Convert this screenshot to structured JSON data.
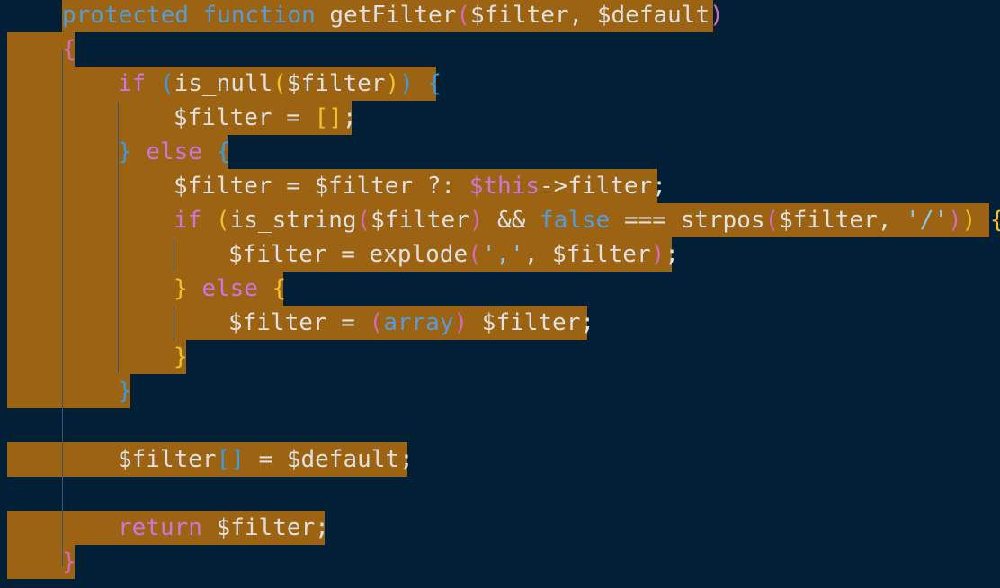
{
  "editor": {
    "language": "php",
    "colors": {
      "background": "#012036",
      "selection": "#9b6312",
      "keyword_purple": "#c778dd",
      "keyword_blue": "#569cd6",
      "text": "#e0e0e0",
      "bracket_gold": "#f2c224",
      "bracket_pink": "#d46ab8",
      "bracket_blue": "#3b9ae1",
      "string": "#8fc6e8"
    },
    "lines": [
      {
        "tokens": [
          [
            "protected",
            "kw-blue"
          ],
          [
            " ",
            ""
          ],
          [
            "function",
            "kw-blue"
          ],
          [
            " getFilter",
            "text"
          ],
          [
            "(",
            "b-pink"
          ],
          [
            "$filter, $default",
            "text"
          ],
          [
            ")",
            "b-pink"
          ]
        ]
      },
      {
        "tokens": [
          [
            "{",
            "b-pink"
          ]
        ]
      },
      {
        "tokens": [
          [
            "if",
            "kw-purple"
          ],
          [
            " ",
            ""
          ],
          [
            "(",
            "b-blue"
          ],
          [
            "is_null",
            "text"
          ],
          [
            "(",
            "b-gold"
          ],
          [
            "$filter",
            "text"
          ],
          [
            ")",
            "b-gold"
          ],
          [
            ")",
            "b-blue"
          ],
          [
            " ",
            ""
          ],
          [
            "{",
            "b-blue"
          ]
        ]
      },
      {
        "tokens": [
          [
            "$filter = ",
            "text"
          ],
          [
            "[]",
            "b-gold"
          ],
          [
            ";",
            "text"
          ]
        ]
      },
      {
        "tokens": [
          [
            "}",
            "b-blue"
          ],
          [
            " ",
            ""
          ],
          [
            "else",
            "kw-purple"
          ],
          [
            " ",
            ""
          ],
          [
            "{",
            "b-blue"
          ]
        ]
      },
      {
        "tokens": [
          [
            "$filter = $filter ?: ",
            "text"
          ],
          [
            "$this",
            "kw-purple"
          ],
          [
            "->filter;",
            "text"
          ]
        ]
      },
      {
        "tokens": [
          [
            "if",
            "kw-purple"
          ],
          [
            " ",
            ""
          ],
          [
            "(",
            "b-gold"
          ],
          [
            "is_string",
            "text"
          ],
          [
            "(",
            "b-pink"
          ],
          [
            "$filter",
            "text"
          ],
          [
            ")",
            "b-pink"
          ],
          [
            " && ",
            "text"
          ],
          [
            "false",
            "kw-blue"
          ],
          [
            " === strpos",
            "text"
          ],
          [
            "(",
            "b-pink"
          ],
          [
            "$filter, ",
            "text"
          ],
          [
            "'/'",
            "string"
          ],
          [
            ")",
            "b-pink"
          ],
          [
            ")",
            "b-gold"
          ],
          [
            " ",
            ""
          ],
          [
            "{",
            "b-gold"
          ]
        ]
      },
      {
        "tokens": [
          [
            "$filter = explode",
            "text"
          ],
          [
            "(",
            "b-pink"
          ],
          [
            "','",
            "string"
          ],
          [
            ", $filter",
            "text"
          ],
          [
            ")",
            "b-pink"
          ],
          [
            ";",
            "text"
          ]
        ]
      },
      {
        "tokens": [
          [
            "}",
            "b-gold"
          ],
          [
            " ",
            ""
          ],
          [
            "else",
            "kw-purple"
          ],
          [
            " ",
            ""
          ],
          [
            "{",
            "b-gold"
          ]
        ]
      },
      {
        "tokens": [
          [
            "$filter = ",
            "text"
          ],
          [
            "(",
            "b-pink"
          ],
          [
            "array",
            "kw-blue"
          ],
          [
            ")",
            "b-pink"
          ],
          [
            " $filter;",
            "text"
          ]
        ]
      },
      {
        "tokens": [
          [
            "}",
            "b-gold"
          ]
        ]
      },
      {
        "tokens": [
          [
            "}",
            "b-blue"
          ]
        ]
      },
      {
        "tokens": []
      },
      {
        "tokens": [
          [
            "$filter",
            "text"
          ],
          [
            "[]",
            "b-blue"
          ],
          [
            " = $default;",
            "text"
          ]
        ]
      },
      {
        "tokens": []
      },
      {
        "tokens": [
          [
            "return",
            "kw-purple"
          ],
          [
            " $filter;",
            "text"
          ]
        ]
      },
      {
        "tokens": [
          [
            "}",
            "b-pink"
          ]
        ]
      }
    ]
  }
}
